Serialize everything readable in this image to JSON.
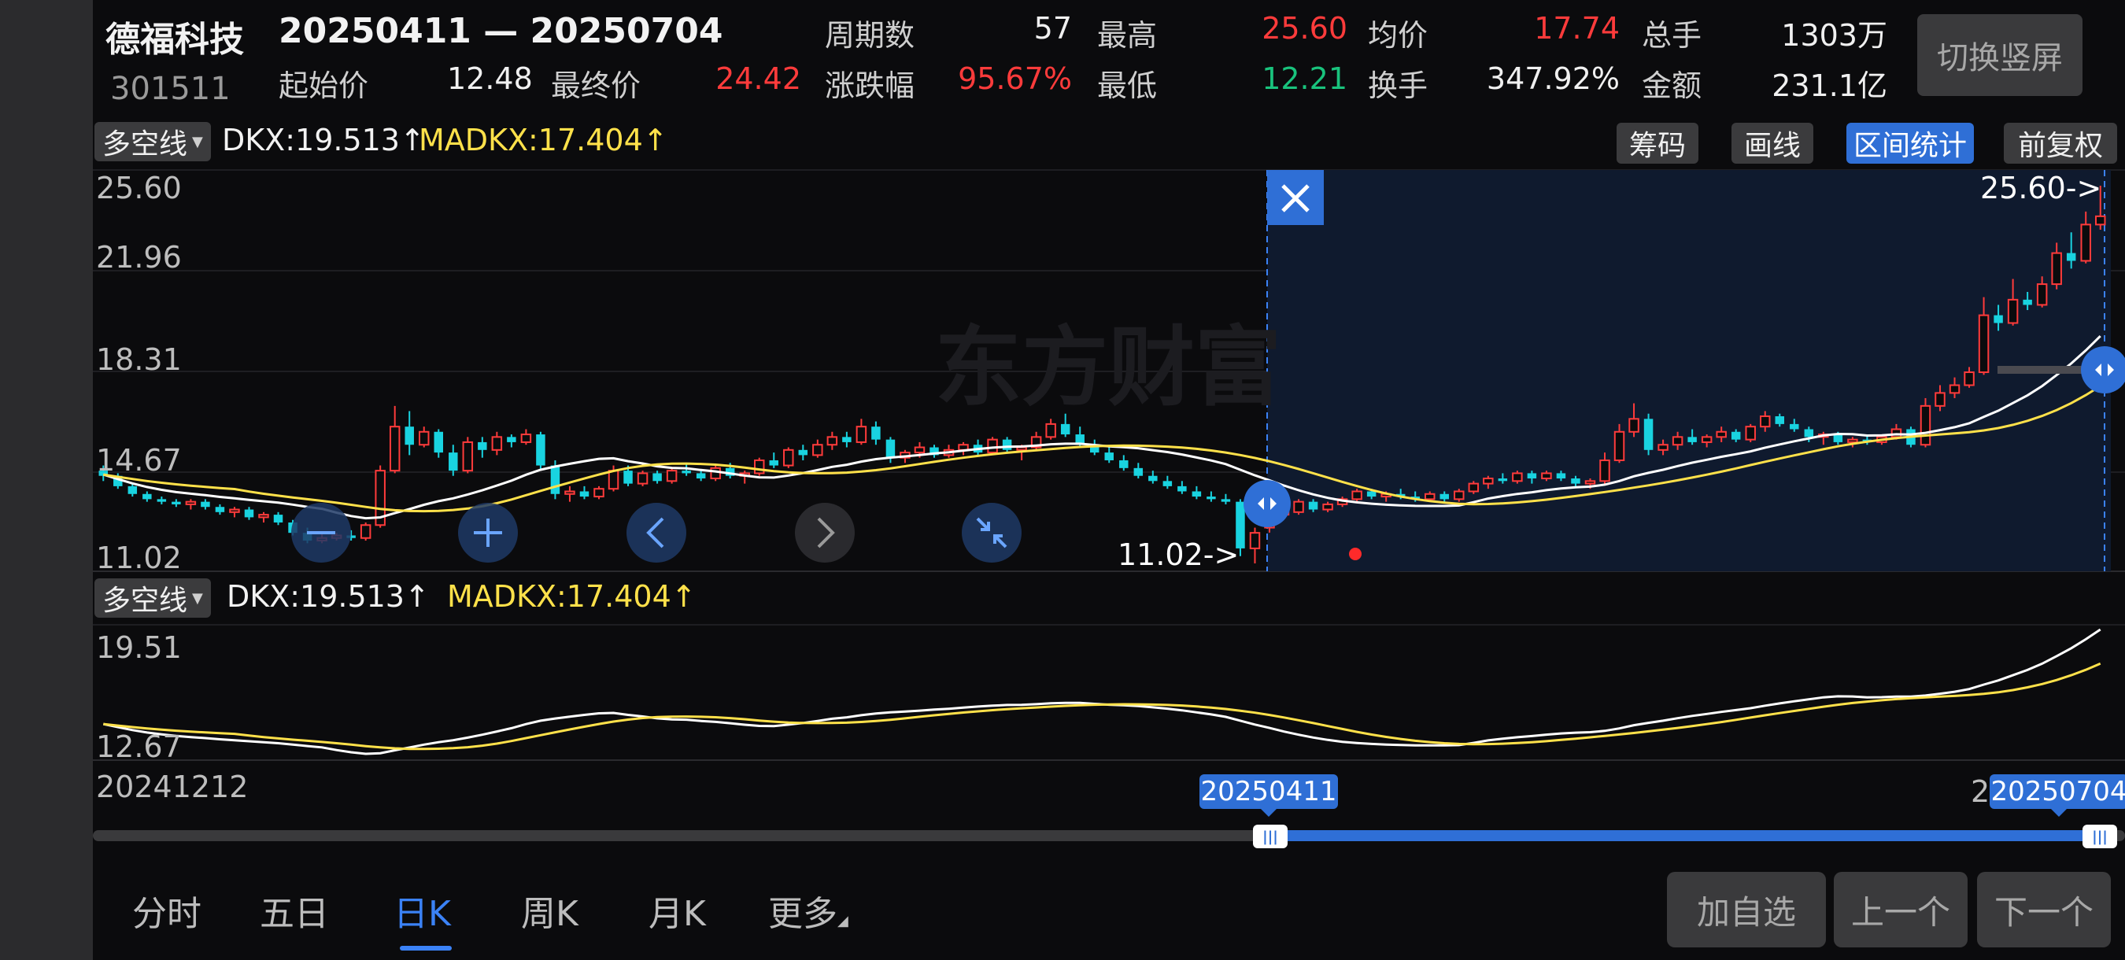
{
  "header": {
    "stock_name": "德福科技",
    "stock_code": "301511",
    "range_text": "20250411 — 20250704",
    "stats": {
      "periods_label": "周期数",
      "periods_value": "57",
      "high_label": "最高",
      "high_value": "25.60",
      "avg_label": "均价",
      "avg_value": "17.74",
      "total_label": "总手",
      "total_value": "1303万",
      "start_label": "起始价",
      "start_value": "12.48",
      "final_label": "最终价",
      "final_value": "24.42",
      "change_label": "涨跌幅",
      "change_value": "95.67%",
      "low_label": "最低",
      "low_value": "12.21",
      "turnover_label": "换手",
      "turnover_value": "347.92%",
      "amount_label": "金额",
      "amount_value": "231.1亿"
    },
    "switch_button": "切换竖屏"
  },
  "indicator_top": {
    "selector": "多空线",
    "dkx_text": "DKX:19.513↑",
    "madkx_text": "MADKX:17.404↑"
  },
  "toolbar": {
    "chips": "筹码",
    "draw": "画线",
    "range_stats": "区间统计",
    "adjust": "前复权"
  },
  "main_chart": {
    "y_labels": [
      "25.60",
      "21.96",
      "18.31",
      "14.67",
      "11.02"
    ],
    "high_marker": "25.60->",
    "low_marker": "11.02->",
    "watermark": "东方财富"
  },
  "indicator_bottom": {
    "selector": "多空线",
    "dkx_text": "DKX:19.513↑",
    "madkx_text": "MADKX:17.404↑",
    "y_labels": [
      "19.51",
      "12.67"
    ]
  },
  "timeline": {
    "start_date": "20241212",
    "sel_start": "20250411",
    "sel_end": "20250704",
    "right_cut": "2"
  },
  "tabs": [
    "分时",
    "五日",
    "日K",
    "周K",
    "月K",
    "更多"
  ],
  "active_tab": "日K",
  "buttons": {
    "add_watch": "加自选",
    "prev": "上一个",
    "next": "下一个"
  },
  "colors": {
    "up": "#ff3b3b",
    "down": "#19d3e0",
    "dkx": "#ffffff",
    "madkx": "#ffe14a",
    "accent": "#2f6fd6"
  },
  "chart_data": {
    "type": "candlestick",
    "price_range": [
      11.02,
      25.6
    ],
    "y_ticks": [
      25.6,
      21.96,
      18.31,
      14.67,
      11.02
    ],
    "candles": [
      [
        14.6,
        14.8,
        14.2,
        14.4
      ],
      [
        14.4,
        14.5,
        13.9,
        14.0
      ],
      [
        14.0,
        14.1,
        13.6,
        13.7
      ],
      [
        13.7,
        13.8,
        13.4,
        13.5
      ],
      [
        13.5,
        13.6,
        13.3,
        13.4
      ],
      [
        13.4,
        13.5,
        13.2,
        13.3
      ],
      [
        13.3,
        13.5,
        13.1,
        13.4
      ],
      [
        13.4,
        13.5,
        13.1,
        13.2
      ],
      [
        13.2,
        13.3,
        12.9,
        13.0
      ],
      [
        13.0,
        13.2,
        12.8,
        13.1
      ],
      [
        13.1,
        13.2,
        12.7,
        12.8
      ],
      [
        12.8,
        13.0,
        12.6,
        12.9
      ],
      [
        12.9,
        13.0,
        12.5,
        12.6
      ],
      [
        12.6,
        12.7,
        12.1,
        12.2
      ],
      [
        12.2,
        12.4,
        11.8,
        11.9
      ],
      [
        11.9,
        12.2,
        11.8,
        12.0
      ],
      [
        12.0,
        12.2,
        11.9,
        12.1
      ],
      [
        12.1,
        12.3,
        11.9,
        12.0
      ],
      [
        12.0,
        12.6,
        11.9,
        12.5
      ],
      [
        12.5,
        14.8,
        12.4,
        14.6
      ],
      [
        14.6,
        17.1,
        14.5,
        16.3
      ],
      [
        16.3,
        16.9,
        15.2,
        15.6
      ],
      [
        15.6,
        16.3,
        15.5,
        16.1
      ],
      [
        16.1,
        16.2,
        15.1,
        15.3
      ],
      [
        15.3,
        15.6,
        14.4,
        14.6
      ],
      [
        14.6,
        15.9,
        14.5,
        15.7
      ],
      [
        15.7,
        15.9,
        15.1,
        15.4
      ],
      [
        15.4,
        16.1,
        15.2,
        15.9
      ],
      [
        15.9,
        16.0,
        15.5,
        15.7
      ],
      [
        15.7,
        16.2,
        15.6,
        16.0
      ],
      [
        16.0,
        16.1,
        14.6,
        14.8
      ],
      [
        14.8,
        15.0,
        13.5,
        13.7
      ],
      [
        13.7,
        14.0,
        13.4,
        13.8
      ],
      [
        13.8,
        14.0,
        13.5,
        13.6
      ],
      [
        13.6,
        14.0,
        13.5,
        13.9
      ],
      [
        13.9,
        14.8,
        13.8,
        14.6
      ],
      [
        14.6,
        14.8,
        14.0,
        14.1
      ],
      [
        14.1,
        14.6,
        14.0,
        14.5
      ],
      [
        14.5,
        14.6,
        14.1,
        14.2
      ],
      [
        14.2,
        14.7,
        14.1,
        14.6
      ],
      [
        14.6,
        14.9,
        14.4,
        14.5
      ],
      [
        14.5,
        14.6,
        14.2,
        14.3
      ],
      [
        14.3,
        14.8,
        14.2,
        14.7
      ],
      [
        14.7,
        14.9,
        14.3,
        14.4
      ],
      [
        14.4,
        14.6,
        14.1,
        14.5
      ],
      [
        14.5,
        15.1,
        14.4,
        15.0
      ],
      [
        15.0,
        15.3,
        14.7,
        14.8
      ],
      [
        14.8,
        15.5,
        14.7,
        15.4
      ],
      [
        15.4,
        15.6,
        15.0,
        15.2
      ],
      [
        15.2,
        15.8,
        15.1,
        15.6
      ],
      [
        15.6,
        16.1,
        15.4,
        15.9
      ],
      [
        15.9,
        16.1,
        15.5,
        15.7
      ],
      [
        15.7,
        16.6,
        15.6,
        16.3
      ],
      [
        16.3,
        16.5,
        15.6,
        15.8
      ],
      [
        15.8,
        15.9,
        14.9,
        15.1
      ],
      [
        15.1,
        15.4,
        14.9,
        15.3
      ],
      [
        15.3,
        15.7,
        15.1,
        15.5
      ],
      [
        15.5,
        15.6,
        15.1,
        15.2
      ],
      [
        15.2,
        15.6,
        15.1,
        15.4
      ],
      [
        15.4,
        15.7,
        15.2,
        15.6
      ],
      [
        15.6,
        15.8,
        15.2,
        15.3
      ],
      [
        15.3,
        15.9,
        15.2,
        15.8
      ],
      [
        15.8,
        15.9,
        15.3,
        15.4
      ],
      [
        15.4,
        15.6,
        15.0,
        15.5
      ],
      [
        15.5,
        16.1,
        15.4,
        15.9
      ],
      [
        15.9,
        16.6,
        15.8,
        16.4
      ],
      [
        16.4,
        16.8,
        15.9,
        16.0
      ],
      [
        16.0,
        16.3,
        15.5,
        15.6
      ],
      [
        15.6,
        15.8,
        15.2,
        15.3
      ],
      [
        15.3,
        15.5,
        14.9,
        15.0
      ],
      [
        15.0,
        15.2,
        14.6,
        14.7
      ],
      [
        14.7,
        14.9,
        14.3,
        14.4
      ],
      [
        14.4,
        14.6,
        14.1,
        14.2
      ],
      [
        14.2,
        14.4,
        13.9,
        14.0
      ],
      [
        14.0,
        14.2,
        13.7,
        13.8
      ],
      [
        13.8,
        14.0,
        13.5,
        13.6
      ],
      [
        13.6,
        13.8,
        13.4,
        13.5
      ],
      [
        13.5,
        13.7,
        13.3,
        13.4
      ],
      [
        13.4,
        13.5,
        11.3,
        11.6
      ],
      [
        11.6,
        12.4,
        11.02,
        12.2
      ],
      [
        12.4,
        13.0,
        12.21,
        12.9
      ],
      [
        12.9,
        13.4,
        12.8,
        13.0
      ],
      [
        13.0,
        13.5,
        12.9,
        13.4
      ],
      [
        13.4,
        13.5,
        13.0,
        13.1
      ],
      [
        13.1,
        13.4,
        13.0,
        13.3
      ],
      [
        13.3,
        13.6,
        13.2,
        13.5
      ],
      [
        13.5,
        13.9,
        13.4,
        13.8
      ],
      [
        13.8,
        13.9,
        13.5,
        13.6
      ],
      [
        13.6,
        13.8,
        13.4,
        13.7
      ],
      [
        13.7,
        13.9,
        13.5,
        13.6
      ],
      [
        13.6,
        13.8,
        13.4,
        13.5
      ],
      [
        13.5,
        13.8,
        13.4,
        13.7
      ],
      [
        13.7,
        13.8,
        13.4,
        13.5
      ],
      [
        13.5,
        13.9,
        13.4,
        13.8
      ],
      [
        13.8,
        14.2,
        13.7,
        14.1
      ],
      [
        14.1,
        14.4,
        13.9,
        14.3
      ],
      [
        14.3,
        14.5,
        14.1,
        14.2
      ],
      [
        14.2,
        14.6,
        14.1,
        14.5
      ],
      [
        14.5,
        14.6,
        14.1,
        14.3
      ],
      [
        14.3,
        14.6,
        14.2,
        14.5
      ],
      [
        14.5,
        14.6,
        14.2,
        14.3
      ],
      [
        14.3,
        14.4,
        14.0,
        14.1
      ],
      [
        14.1,
        14.3,
        13.9,
        14.2
      ],
      [
        14.2,
        15.3,
        14.1,
        15.0
      ],
      [
        15.0,
        16.4,
        14.9,
        16.1
      ],
      [
        16.1,
        17.2,
        15.9,
        16.6
      ],
      [
        16.6,
        16.8,
        15.2,
        15.4
      ],
      [
        15.4,
        15.8,
        15.2,
        15.6
      ],
      [
        15.6,
        16.1,
        15.4,
        15.9
      ],
      [
        15.9,
        16.2,
        15.6,
        15.7
      ],
      [
        15.7,
        16.0,
        15.5,
        15.9
      ],
      [
        15.9,
        16.3,
        15.7,
        16.1
      ],
      [
        16.1,
        16.2,
        15.7,
        15.8
      ],
      [
        15.8,
        16.4,
        15.7,
        16.3
      ],
      [
        16.3,
        16.9,
        16.1,
        16.7
      ],
      [
        16.7,
        16.8,
        16.3,
        16.4
      ],
      [
        16.4,
        16.6,
        16.1,
        16.2
      ],
      [
        16.2,
        16.3,
        15.7,
        15.9
      ],
      [
        15.9,
        16.1,
        15.6,
        16.0
      ],
      [
        16.0,
        16.1,
        15.6,
        15.7
      ],
      [
        15.7,
        15.9,
        15.5,
        15.8
      ],
      [
        15.8,
        16.0,
        15.6,
        15.7
      ],
      [
        15.7,
        16.0,
        15.6,
        15.9
      ],
      [
        15.9,
        16.4,
        15.8,
        16.2
      ],
      [
        16.2,
        16.3,
        15.5,
        15.6
      ],
      [
        15.6,
        17.4,
        15.5,
        17.1
      ],
      [
        17.1,
        17.9,
        16.9,
        17.6
      ],
      [
        17.6,
        18.2,
        17.4,
        17.9
      ],
      [
        17.9,
        18.6,
        17.8,
        18.4
      ],
      [
        18.4,
        21.3,
        18.3,
        20.6
      ],
      [
        20.6,
        21.0,
        20.0,
        20.3
      ],
      [
        20.3,
        22.0,
        20.2,
        21.2
      ],
      [
        21.2,
        21.5,
        20.8,
        21.0
      ],
      [
        21.0,
        22.1,
        20.9,
        21.8
      ],
      [
        21.8,
        23.4,
        21.6,
        23.0
      ],
      [
        23.0,
        23.8,
        22.4,
        22.7
      ],
      [
        22.7,
        24.6,
        22.6,
        24.1
      ],
      [
        24.1,
        25.6,
        23.9,
        24.42
      ]
    ],
    "dkx_line": "DKX",
    "madkx_line": "MADKX",
    "selection": {
      "start": "20250411",
      "end": "20250704"
    }
  }
}
